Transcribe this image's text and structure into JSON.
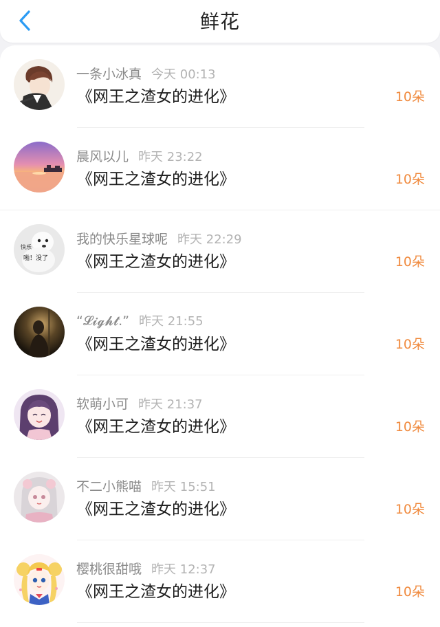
{
  "header": {
    "title": "鲜花",
    "back_icon": "chevron-left-icon",
    "accent": "#2b9bf4"
  },
  "colors": {
    "amount": "#f08a3e",
    "name": "#8a8a8a",
    "time": "#b3b3b3"
  },
  "records": [
    {
      "name": "一条小冰真",
      "time": "今天 00:13",
      "book": "《网王之渣女的进化》",
      "amount": "10朵",
      "avatar": "avatar-anime-boy"
    },
    {
      "name": "晨风以儿",
      "time": "昨天 23:22",
      "book": "《网王之渣女的进化》",
      "amount": "10朵",
      "avatar": "avatar-sunset"
    },
    {
      "name": "我的快乐星球呢",
      "time": "昨天 22:29",
      "book": "《网王之渣女的进化》",
      "amount": "10朵",
      "avatar": "avatar-dog-meme"
    },
    {
      "name": "“𝓛𝓲𝓰𝓱𝓽.”",
      "time": "昨天 21:55",
      "book": "《网王之渣女的进化》",
      "amount": "10朵",
      "avatar": "avatar-dark-figure"
    },
    {
      "name": "软萌小可",
      "time": "昨天 21:37",
      "book": "《网王之渣女的进化》",
      "amount": "10朵",
      "avatar": "avatar-anime-girl-purple"
    },
    {
      "name": "不二小熊喵",
      "time": "昨天 15:51",
      "book": "《网王之渣女的进化》",
      "amount": "10朵",
      "avatar": "avatar-anime-girl-pink"
    },
    {
      "name": "樱桃很甜哦",
      "time": "昨天 12:37",
      "book": "《网王之渣女的进化》",
      "amount": "10朵",
      "avatar": "avatar-sailor-moon"
    }
  ]
}
